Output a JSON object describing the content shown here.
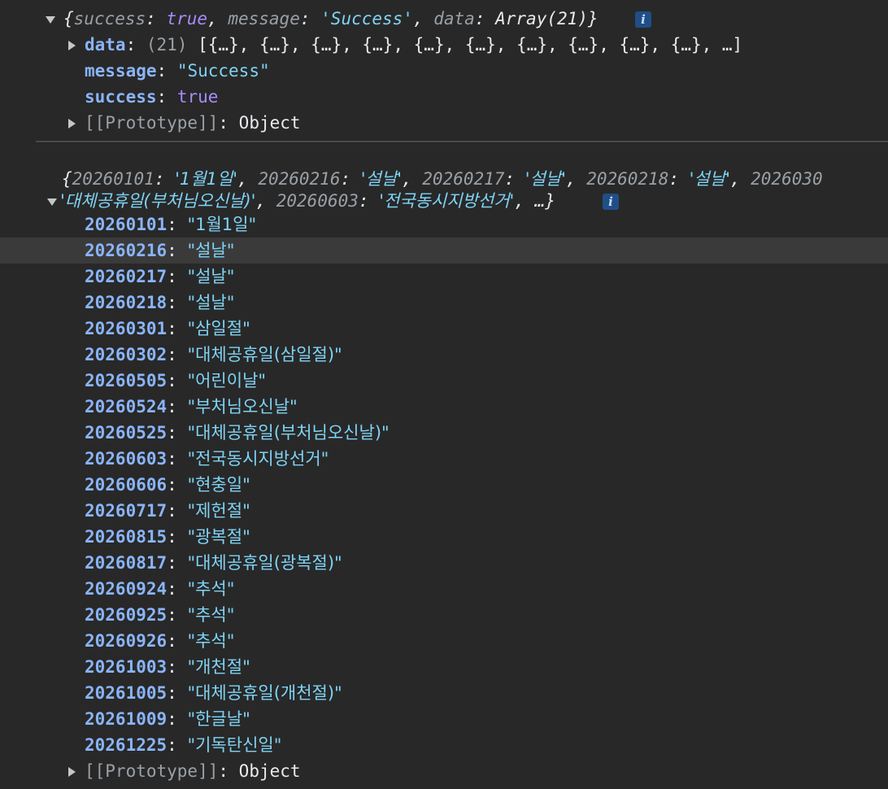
{
  "obj1": {
    "preview": {
      "open": "{",
      "k1": "success",
      "v1": "true",
      "k2": "message",
      "v2": "'Success'",
      "k3": "data",
      "v3": "Array(21)",
      "close": "}"
    },
    "info_label": "i",
    "data_key": "data",
    "data_count": "(21)",
    "data_preview": "[{…}, {…}, {…}, {…}, {…}, {…}, {…}, {…}, {…}, {…}, …]",
    "message_key": "message",
    "message_val": "\"Success\"",
    "success_key": "success",
    "success_val": "true",
    "proto_key": "[[Prototype]]",
    "proto_val": "Object"
  },
  "obj2": {
    "preview_line1": {
      "open": "{",
      "k1": "20260101",
      "v1": "'1월1일'",
      "k2": "20260216",
      "v2": "'설날'",
      "k3": "20260217",
      "v3": "'설날'",
      "k4": "20260218",
      "v4": "'설날'",
      "k5": "2026030"
    },
    "preview_line2": {
      "v5": "'대체공휴일(부처님오신날)'",
      "k6": "20260603",
      "v6": "'전국동시지방선거'",
      "tail": "…}"
    },
    "info_label": "i",
    "entries": [
      {
        "key": "20260101",
        "value": "\"1월1일\""
      },
      {
        "key": "20260216",
        "value": "\"설날\""
      },
      {
        "key": "20260217",
        "value": "\"설날\""
      },
      {
        "key": "20260218",
        "value": "\"설날\""
      },
      {
        "key": "20260301",
        "value": "\"삼일절\""
      },
      {
        "key": "20260302",
        "value": "\"대체공휴일(삼일절)\""
      },
      {
        "key": "20260505",
        "value": "\"어린이날\""
      },
      {
        "key": "20260524",
        "value": "\"부처님오신날\""
      },
      {
        "key": "20260525",
        "value": "\"대체공휴일(부처님오신날)\""
      },
      {
        "key": "20260603",
        "value": "\"전국동시지방선거\""
      },
      {
        "key": "20260606",
        "value": "\"현충일\""
      },
      {
        "key": "20260717",
        "value": "\"제헌절\""
      },
      {
        "key": "20260815",
        "value": "\"광복절\""
      },
      {
        "key": "20260817",
        "value": "\"대체공휴일(광복절)\""
      },
      {
        "key": "20260924",
        "value": "\"추석\""
      },
      {
        "key": "20260925",
        "value": "\"추석\""
      },
      {
        "key": "20260926",
        "value": "\"추석\""
      },
      {
        "key": "20261003",
        "value": "\"개천절\""
      },
      {
        "key": "20261005",
        "value": "\"대체공휴일(개천절)\""
      },
      {
        "key": "20261009",
        "value": "\"한글날\""
      },
      {
        "key": "20261225",
        "value": "\"기독탄신일\""
      }
    ],
    "proto_key": "[[Prototype]]",
    "proto_val": "Object"
  },
  "colors": {
    "background": "#282828",
    "key": "#8ab4f8",
    "string": "#7fd3f5",
    "keyword": "#a78bfa",
    "hover": "#3a3a3a"
  }
}
